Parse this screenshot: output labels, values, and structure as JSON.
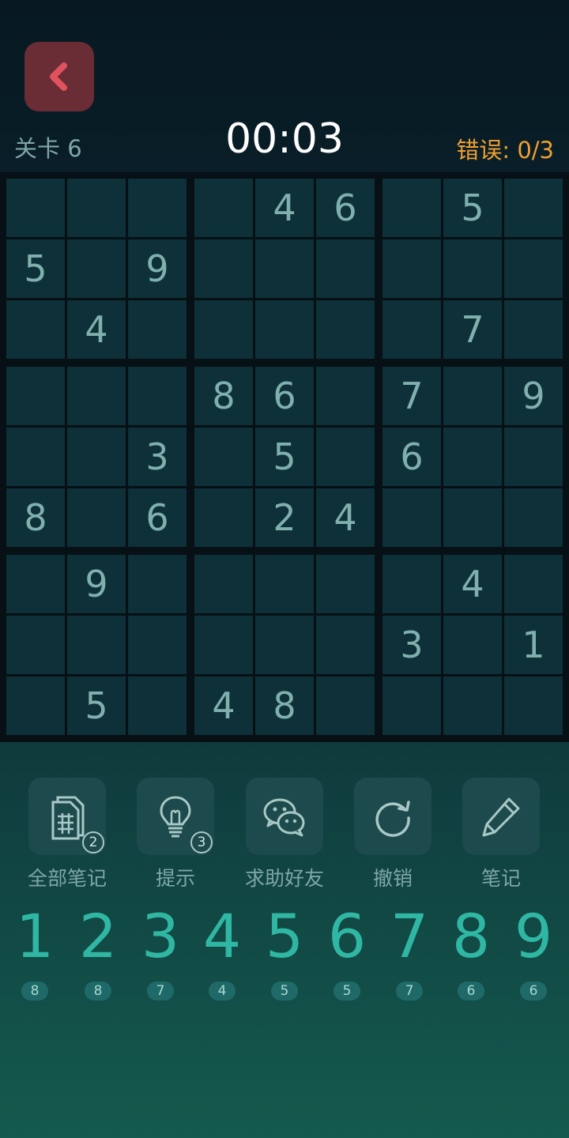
{
  "header": {
    "level": "关卡 6",
    "timer": "00:03",
    "errors_label": "错误: ",
    "errors_value": "0/3",
    "back_icon": "chevron-left-icon"
  },
  "board": [
    [
      "",
      "",
      "",
      "",
      "4",
      "6",
      "",
      "5",
      ""
    ],
    [
      "5",
      "",
      "9",
      "",
      "",
      "",
      "",
      "",
      ""
    ],
    [
      "",
      "4",
      "",
      "",
      "",
      "",
      "",
      "7",
      ""
    ],
    [
      "",
      "",
      "",
      "8",
      "6",
      "",
      "7",
      "",
      "9"
    ],
    [
      "",
      "",
      "3",
      "",
      "5",
      "",
      "6",
      "",
      ""
    ],
    [
      "8",
      "",
      "6",
      "",
      "2",
      "4",
      "",
      "",
      ""
    ],
    [
      "",
      "9",
      "",
      "",
      "",
      "",
      "",
      "4",
      ""
    ],
    [
      "",
      "",
      "",
      "",
      "",
      "",
      "3",
      "",
      "1"
    ],
    [
      "",
      "5",
      "",
      "4",
      "8",
      "",
      "",
      "",
      ""
    ]
  ],
  "tools": [
    {
      "label": "全部笔记",
      "icon": "notes-grid-icon",
      "badge": "2"
    },
    {
      "label": "提示",
      "icon": "lightbulb-icon",
      "badge": "3"
    },
    {
      "label": "求助好友",
      "icon": "wechat-icon",
      "badge": ""
    },
    {
      "label": "撤销",
      "icon": "undo-icon",
      "badge": ""
    },
    {
      "label": "笔记",
      "icon": "pencil-icon",
      "badge": ""
    }
  ],
  "numpad": [
    {
      "digit": "1",
      "count": "8"
    },
    {
      "digit": "2",
      "count": "8"
    },
    {
      "digit": "3",
      "count": "7"
    },
    {
      "digit": "4",
      "count": "4"
    },
    {
      "digit": "5",
      "count": "5"
    },
    {
      "digit": "6",
      "count": "5"
    },
    {
      "digit": "7",
      "count": "7"
    },
    {
      "digit": "8",
      "count": "6"
    },
    {
      "digit": "9",
      "count": "6"
    }
  ],
  "colors": {
    "accent": "#2fb7a4",
    "error": "#f0a030",
    "back_button": "#6a2d36",
    "back_icon": "#e0535e"
  }
}
